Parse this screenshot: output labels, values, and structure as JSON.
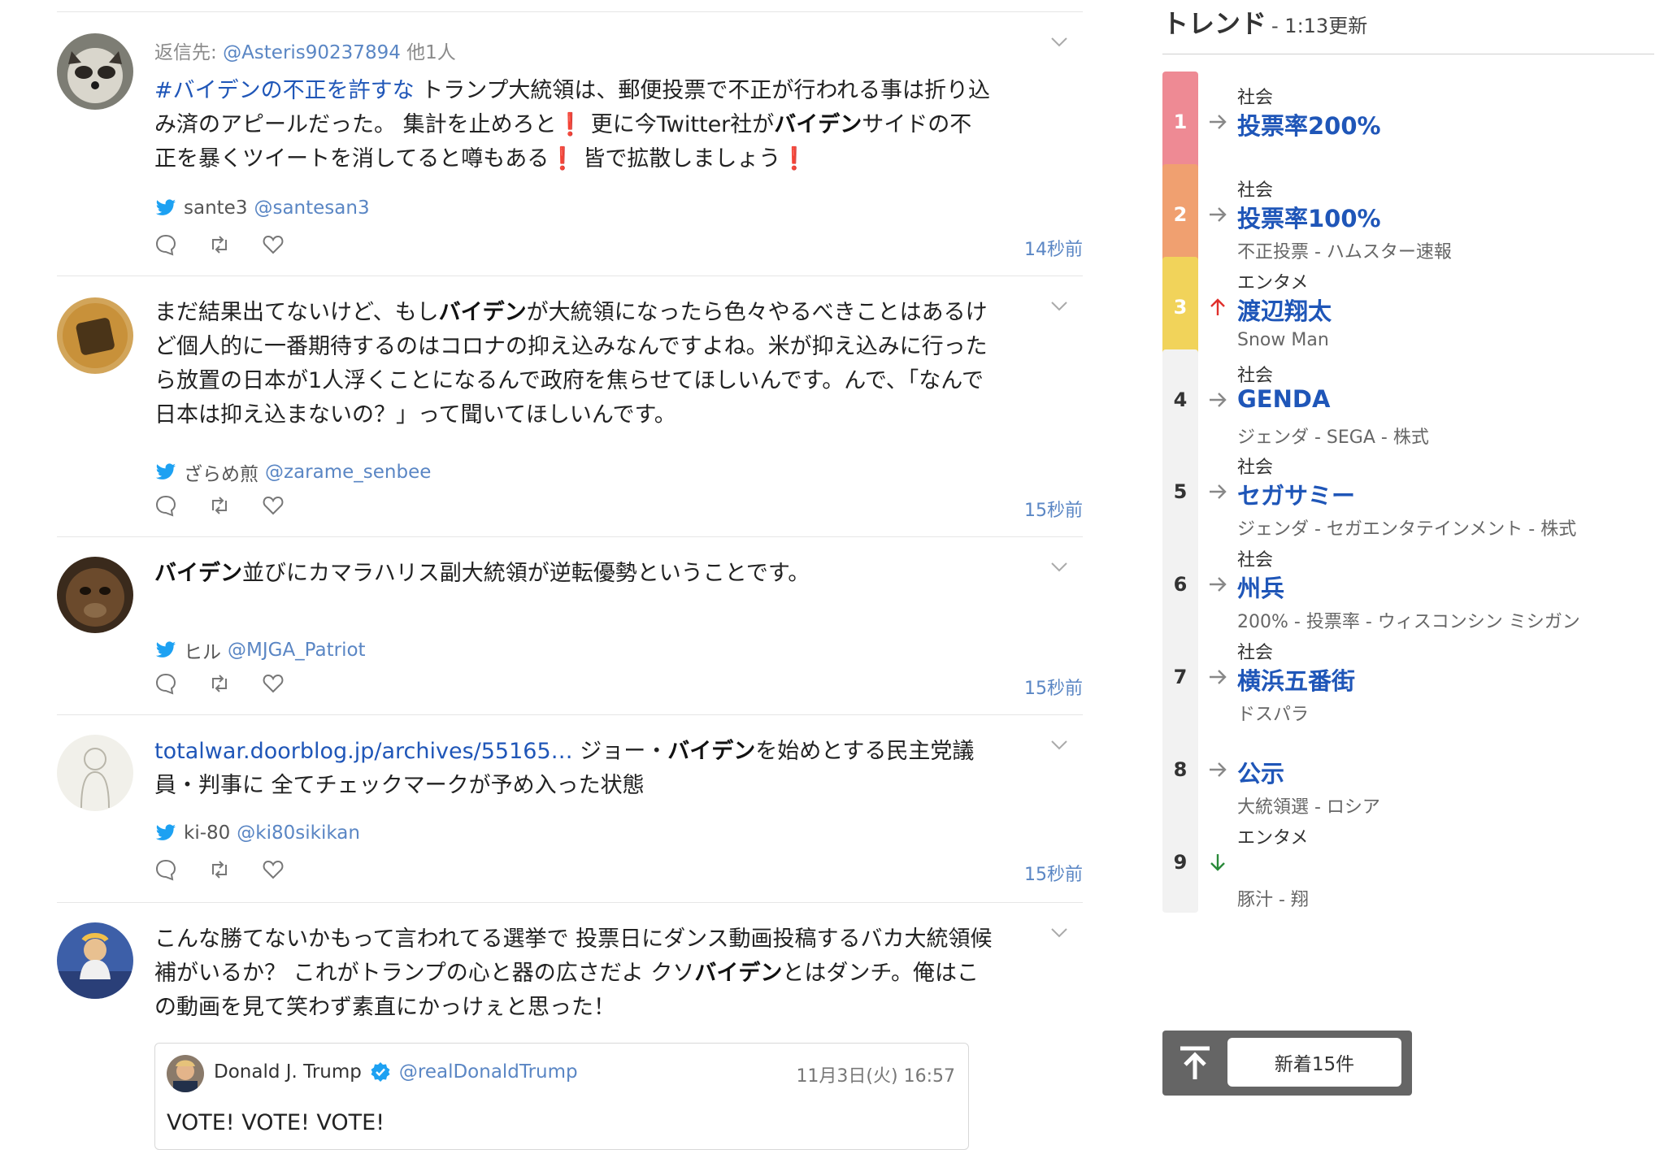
{
  "feed": {
    "tweets": [
      {
        "reply_to_prefix": "返信先:",
        "reply_to_handle": "@Asteris90237894",
        "reply_to_more": "他1人",
        "text_parts": [
          {
            "t": "#バイデンの不正を許すな",
            "s": "hash"
          },
          {
            "t": " トランプ大統領は、郵便投票で不正が行われる事は折り込み済のアピールだった。 集計を止めろと❗️ 更に今Twitter社が",
            "s": ""
          },
          {
            "t": "バイデン",
            "s": "b"
          },
          {
            "t": "サイドの不正を暴くツイートを消してると噂もある❗️ 皆で拡散しましょう❗️",
            "s": ""
          }
        ],
        "author_name": "sante3",
        "author_handle": "@santesan3",
        "time": "14秒前"
      },
      {
        "text_parts": [
          {
            "t": "まだ結果出てないけど、もし",
            "s": ""
          },
          {
            "t": "バイデン",
            "s": "b"
          },
          {
            "t": "が大統領になったら色々やるべきことはあるけど個人的に一番期待するのはコロナの抑え込みなんですよね。米が抑え込みに行ったら放置の日本が1人浮くことになるんで政府を焦らせてほしいんです。んで、「なんで日本は抑え込まないの？」って聞いてほしいんです。",
            "s": ""
          }
        ],
        "author_name": "ざらめ煎",
        "author_handle": "@zarame_senbee",
        "time": "15秒前"
      },
      {
        "text_parts": [
          {
            "t": "バイデン",
            "s": "b"
          },
          {
            "t": "並びにカマラハリス副大統領が逆転優勢ということです。",
            "s": ""
          }
        ],
        "author_name": "ヒル",
        "author_handle": "@MJGA_Patriot",
        "time": "15秒前"
      },
      {
        "text_parts": [
          {
            "t": "totalwar.doorblog.jp/archives/55165…",
            "s": "url"
          },
          {
            "t": " ジョー・",
            "s": ""
          },
          {
            "t": "バイデン",
            "s": "b"
          },
          {
            "t": "を始めとする民主党議員・判事に 全てチェックマークが予め入った状態",
            "s": ""
          }
        ],
        "author_name": "ki-80",
        "author_handle": "@ki80sikikan",
        "time": "15秒前"
      },
      {
        "text_parts": [
          {
            "t": "こんな勝てないかもって言われてる選挙で 投票日にダンス動画投稿するバカ大統領候補がいるか？ これがトランプの心と器の広さだよ クソ",
            "s": ""
          },
          {
            "t": "バイデン",
            "s": "b"
          },
          {
            "t": "とはダンチ。俺はこの動画を見て笑わず素直にかっけぇと思った！",
            "s": ""
          }
        ],
        "quote": {
          "name": "Donald J. Trump",
          "handle": "@realDonaldTrump",
          "time": "11月3日(火) 16:57",
          "text": "VOTE! VOTE! VOTE!"
        }
      }
    ]
  },
  "trends": {
    "title": "トレンド",
    "updated": "-  1:13更新",
    "items": [
      {
        "rank": "1",
        "category": "社会",
        "name": "投票率200%",
        "sub": "",
        "color": "#ee8a94",
        "arrow": "flat"
      },
      {
        "rank": "2",
        "category": "社会",
        "name": "投票率100%",
        "sub": "不正投票 - ハムスター速報",
        "color": "#f0a070",
        "arrow": "flat"
      },
      {
        "rank": "3",
        "category": "エンタメ",
        "name": "渡辺翔太",
        "sub": "Snow Man",
        "color": "#f1d35a",
        "arrow": "up"
      },
      {
        "rank": "4",
        "category": "社会",
        "name": "GENDA",
        "sub": "ジェンダ - SEGA - 株式",
        "color": "",
        "arrow": "flat"
      },
      {
        "rank": "5",
        "category": "社会",
        "name": "セガサミー",
        "sub": "ジェンダ - セガエンタテインメント - 株式",
        "color": "",
        "arrow": "flat"
      },
      {
        "rank": "6",
        "category": "社会",
        "name": "州兵",
        "sub": "200% - 投票率 - ウィスコンシン ミシガン",
        "color": "",
        "arrow": "flat"
      },
      {
        "rank": "7",
        "category": "社会",
        "name": "横浜五番街",
        "sub": "ドスパラ",
        "color": "",
        "arrow": "flat"
      },
      {
        "rank": "8",
        "category": "",
        "name": "公示",
        "sub": "大統領選 - ロシア",
        "color": "",
        "arrow": "flat"
      },
      {
        "rank": "9",
        "category": "エンタメ",
        "name": "",
        "sub": "豚汁 - 翔",
        "color": "",
        "arrow": "down"
      }
    ]
  },
  "new_tweets_button": "新着15件",
  "colors": {
    "link": "#1f56b8",
    "handle": "#5a86c4",
    "twitter_blue": "#1da1f2",
    "up_arrow": "#e0302c",
    "down_arrow": "#2a8a3a"
  }
}
